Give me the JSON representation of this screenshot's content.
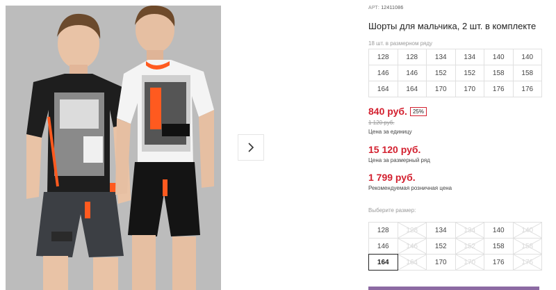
{
  "product": {
    "article_label": "АРТ:",
    "article_value": "12411086",
    "title": "Шорты для мальчика, 2 шт. в комплекте",
    "series_note": "18 шт. в размерном ряду",
    "series_sizes": [
      [
        "128",
        "128",
        "134",
        "134",
        "140",
        "140"
      ],
      [
        "146",
        "146",
        "152",
        "152",
        "158",
        "158"
      ],
      [
        "164",
        "164",
        "170",
        "170",
        "176",
        "176"
      ]
    ]
  },
  "pricing": {
    "price": "840 руб.",
    "discount": "25%",
    "old_price": "1 120 руб.",
    "unit_label": "Цена за единицу",
    "series_price": "15 120 руб.",
    "series_label": "Цена за размерный ряд",
    "rrp_price": "1 799 руб.",
    "rrp_label": "Рекомендуемая розничная цена"
  },
  "size_picker": {
    "label": "Выберите размер:",
    "sizes": [
      {
        "value": "128",
        "available": true
      },
      {
        "value": "128",
        "available": false
      },
      {
        "value": "134",
        "available": true
      },
      {
        "value": "134",
        "available": false
      },
      {
        "value": "140",
        "available": true
      },
      {
        "value": "140",
        "available": false
      },
      {
        "value": "146",
        "available": true
      },
      {
        "value": "146",
        "available": false
      },
      {
        "value": "152",
        "available": true
      },
      {
        "value": "152",
        "available": false
      },
      {
        "value": "158",
        "available": true
      },
      {
        "value": "158",
        "available": false
      },
      {
        "value": "164",
        "available": true,
        "selected": true
      },
      {
        "value": "164",
        "available": false
      },
      {
        "value": "170",
        "available": true
      },
      {
        "value": "170",
        "available": false
      },
      {
        "value": "176",
        "available": true
      },
      {
        "value": "176",
        "available": false
      }
    ]
  },
  "gallery": {
    "next_icon": "chevron-right-icon",
    "photo_bg": "#bfbfbf"
  },
  "colors": {
    "accent_red": "#d3202f",
    "buy_button": "#8c6aa3"
  }
}
